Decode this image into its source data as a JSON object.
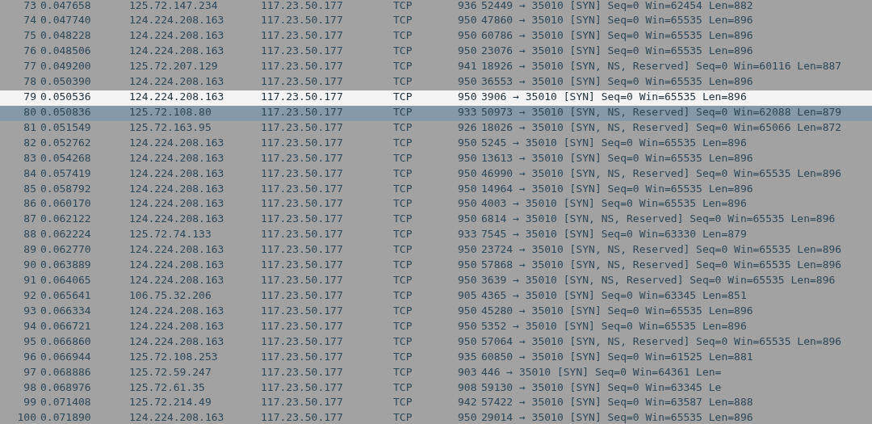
{
  "packet_list": {
    "rows": [
      {
        "cells": [
          "73",
          "0.047658",
          "125.72.147.234",
          "117.23.50.177",
          "TCP",
          "936",
          "52449 → 35010 [SYN] Seq=0 Win=62454 Len=882"
        ],
        "selected": false,
        "highlighted": false
      },
      {
        "cells": [
          "74",
          "0.047740",
          "124.224.208.163",
          "117.23.50.177",
          "TCP",
          "950",
          "47860 → 35010 [SYN] Seq=0 Win=65535 Len=896"
        ],
        "selected": false,
        "highlighted": false
      },
      {
        "cells": [
          "75",
          "0.048228",
          "124.224.208.163",
          "117.23.50.177",
          "TCP",
          "950",
          "60786 → 35010 [SYN] Seq=0 Win=65535 Len=896"
        ],
        "selected": false,
        "highlighted": false
      },
      {
        "cells": [
          "76",
          "0.048506",
          "124.224.208.163",
          "117.23.50.177",
          "TCP",
          "950",
          "23076 → 35010 [SYN] Seq=0 Win=65535 Len=896"
        ],
        "selected": false,
        "highlighted": false
      },
      {
        "cells": [
          "77",
          "0.049200",
          "125.72.207.129",
          "117.23.50.177",
          "TCP",
          "941",
          "18926 → 35010 [SYN, NS, Reserved] Seq=0 Win=60116 Len=887"
        ],
        "selected": false,
        "highlighted": false
      },
      {
        "cells": [
          "78",
          "0.050390",
          "124.224.208.163",
          "117.23.50.177",
          "TCP",
          "950",
          "36553 → 35010 [SYN] Seq=0 Win=65535 Len=896"
        ],
        "selected": false,
        "highlighted": false
      },
      {
        "cells": [
          "79",
          "0.050536",
          "124.224.208.163",
          "117.23.50.177",
          "TCP",
          "950",
          "3906 → 35010 [SYN] Seq=0 Win=65535 Len=896"
        ],
        "selected": true,
        "highlighted": false
      },
      {
        "cells": [
          "80",
          "0.050836",
          "125.72.108.80",
          "117.23.50.177",
          "TCP",
          "933",
          "50973 → 35010 [SYN, NS, Reserved] Seq=0 Win=62088 Len=879"
        ],
        "selected": false,
        "highlighted": true
      },
      {
        "cells": [
          "81",
          "0.051549",
          "125.72.163.95",
          "117.23.50.177",
          "TCP",
          "926",
          "18026 → 35010 [SYN, NS, Reserved] Seq=0 Win=65066 Len=872"
        ],
        "selected": false,
        "highlighted": false
      },
      {
        "cells": [
          "82",
          "0.052762",
          "124.224.208.163",
          "117.23.50.177",
          "TCP",
          "950",
          "5245 → 35010 [SYN] Seq=0 Win=65535 Len=896"
        ],
        "selected": false,
        "highlighted": false
      },
      {
        "cells": [
          "83",
          "0.054268",
          "124.224.208.163",
          "117.23.50.177",
          "TCP",
          "950",
          "13613 → 35010 [SYN] Seq=0 Win=65535 Len=896"
        ],
        "selected": false,
        "highlighted": false
      },
      {
        "cells": [
          "84",
          "0.057419",
          "124.224.208.163",
          "117.23.50.177",
          "TCP",
          "950",
          "46990 → 35010 [SYN, NS, Reserved] Seq=0 Win=65535 Len=896"
        ],
        "selected": false,
        "highlighted": false
      },
      {
        "cells": [
          "85",
          "0.058792",
          "124.224.208.163",
          "117.23.50.177",
          "TCP",
          "950",
          "14964 → 35010 [SYN] Seq=0 Win=65535 Len=896"
        ],
        "selected": false,
        "highlighted": false
      },
      {
        "cells": [
          "86",
          "0.060170",
          "124.224.208.163",
          "117.23.50.177",
          "TCP",
          "950",
          "4003 → 35010 [SYN] Seq=0 Win=65535 Len=896"
        ],
        "selected": false,
        "highlighted": false
      },
      {
        "cells": [
          "87",
          "0.062122",
          "124.224.208.163",
          "117.23.50.177",
          "TCP",
          "950",
          "6814 → 35010 [SYN, NS, Reserved] Seq=0 Win=65535 Len=896"
        ],
        "selected": false,
        "highlighted": false
      },
      {
        "cells": [
          "88",
          "0.062224",
          "125.72.74.133",
          "117.23.50.177",
          "TCP",
          "933",
          "7545 → 35010 [SYN] Seq=0 Win=63330 Len=879"
        ],
        "selected": false,
        "highlighted": false
      },
      {
        "cells": [
          "89",
          "0.062770",
          "124.224.208.163",
          "117.23.50.177",
          "TCP",
          "950",
          "23724 → 35010 [SYN, NS, Reserved] Seq=0 Win=65535 Len=896"
        ],
        "selected": false,
        "highlighted": false
      },
      {
        "cells": [
          "90",
          "0.063889",
          "124.224.208.163",
          "117.23.50.177",
          "TCP",
          "950",
          "57868 → 35010 [SYN, NS, Reserved] Seq=0 Win=65535 Len=896"
        ],
        "selected": false,
        "highlighted": false
      },
      {
        "cells": [
          "91",
          "0.064065",
          "124.224.208.163",
          "117.23.50.177",
          "TCP",
          "950",
          "3639 → 35010 [SYN, NS, Reserved] Seq=0 Win=65535 Len=896"
        ],
        "selected": false,
        "highlighted": false
      },
      {
        "cells": [
          "92",
          "0.065641",
          "106.75.32.206",
          "117.23.50.177",
          "TCP",
          "905",
          "4365 → 35010 [SYN] Seq=0 Win=63345 Len=851"
        ],
        "selected": false,
        "highlighted": false
      },
      {
        "cells": [
          "93",
          "0.066334",
          "124.224.208.163",
          "117.23.50.177",
          "TCP",
          "950",
          "45280 → 35010 [SYN] Seq=0 Win=65535 Len=896"
        ],
        "selected": false,
        "highlighted": false
      },
      {
        "cells": [
          "94",
          "0.066721",
          "124.224.208.163",
          "117.23.50.177",
          "TCP",
          "950",
          "5352 → 35010 [SYN] Seq=0 Win=65535 Len=896"
        ],
        "selected": false,
        "highlighted": false
      },
      {
        "cells": [
          "95",
          "0.066860",
          "124.224.208.163",
          "117.23.50.177",
          "TCP",
          "950",
          "57064 → 35010 [SYN, NS, Reserved] Seq=0 Win=65535 Len=896"
        ],
        "selected": false,
        "highlighted": false
      },
      {
        "cells": [
          "96",
          "0.066944",
          "125.72.108.253",
          "117.23.50.177",
          "TCP",
          "935",
          "60850 → 35010 [SYN] Seq=0 Win=61525 Len=881"
        ],
        "selected": false,
        "highlighted": false
      },
      {
        "cells": [
          "97",
          "0.068886",
          "125.72.59.247",
          "117.23.50.177",
          "TCP",
          "903",
          "446 → 35010 [SYN] Seq=0 Win=64361 Len="
        ],
        "selected": false,
        "highlighted": false
      },
      {
        "cells": [
          "98",
          "0.068976",
          "125.72.61.35",
          "117.23.50.177",
          "TCP",
          "908",
          "59130 → 35010 [SYN] Seq=0 Win=63345 Le"
        ],
        "selected": false,
        "highlighted": false
      },
      {
        "cells": [
          "99",
          "0.071408",
          "125.72.214.49",
          "117.23.50.177",
          "TCP",
          "942",
          "57422 → 35010 [SYN] Seq=0 Win=63587 Len=888"
        ],
        "selected": false,
        "highlighted": false
      },
      {
        "cells": [
          "100",
          "0.071890",
          "124.224.208.163",
          "117.23.50.177",
          "TCP",
          "950",
          "29014 → 35010 [SYN] Seq=0 Win=65535 Len=896"
        ],
        "selected": false,
        "highlighted": false
      }
    ]
  }
}
